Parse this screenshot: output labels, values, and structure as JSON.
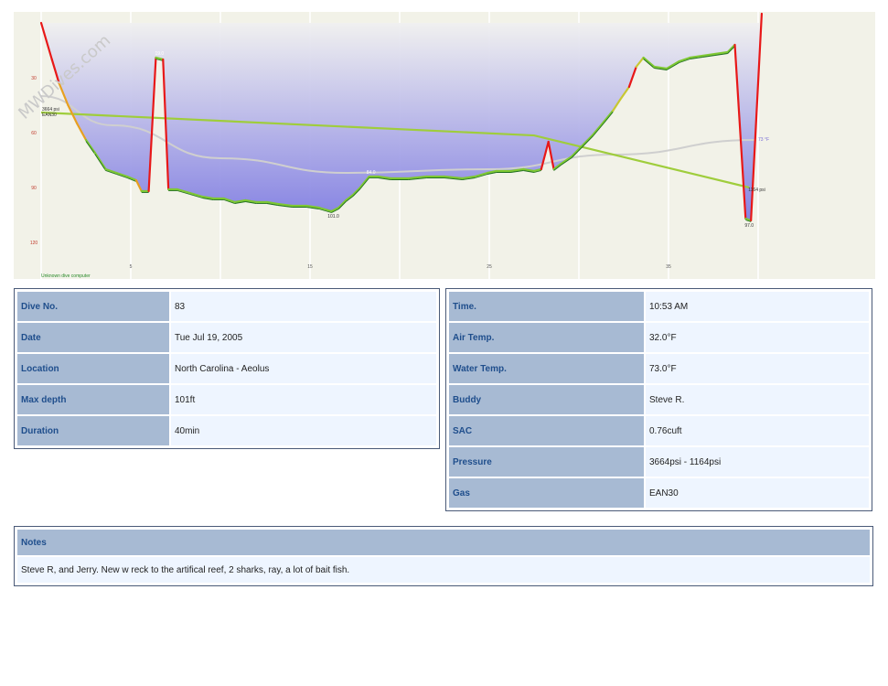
{
  "chart_data": {
    "type": "line",
    "title": "",
    "xlabel": "",
    "ylabel": "",
    "xlim": [
      -1,
      41
    ],
    "ylim": [
      0,
      130
    ],
    "y_inverted": true,
    "x_ticks": [
      5,
      15,
      25,
      35
    ],
    "y_ticks": [
      30,
      60,
      90,
      120
    ],
    "watermark": "MWDives.com",
    "computer_label": "Unknown dive computer",
    "colors": {
      "background": "#f2f2e8",
      "profile_fill": "#8d8ae6",
      "depth_line": "#7ec832",
      "ascent_fast": "#e81818",
      "descent": "#e8a020",
      "pressure": "#6ec832",
      "temperature": "#cccccc"
    },
    "depth_profile": [
      [
        0.0,
        0
      ],
      [
        0.6,
        20
      ],
      [
        1.0,
        33
      ],
      [
        1.5,
        45
      ],
      [
        2.0,
        55
      ],
      [
        2.5,
        64
      ],
      [
        3.0,
        71
      ],
      [
        3.6,
        80
      ],
      [
        4.2,
        82
      ],
      [
        4.8,
        84
      ],
      [
        5.3,
        86
      ],
      [
        5.6,
        92
      ],
      [
        6.0,
        92
      ],
      [
        6.4,
        19
      ],
      [
        6.8,
        20
      ],
      [
        7.1,
        91
      ],
      [
        7.6,
        91
      ],
      [
        8.3,
        93
      ],
      [
        9.0,
        95
      ],
      [
        9.6,
        96
      ],
      [
        10.2,
        96
      ],
      [
        10.8,
        98
      ],
      [
        11.4,
        97
      ],
      [
        12.0,
        98
      ],
      [
        12.6,
        98
      ],
      [
        13.2,
        99
      ],
      [
        14.0,
        100
      ],
      [
        14.8,
        100
      ],
      [
        15.5,
        101
      ],
      [
        16.2,
        103
      ],
      [
        16.6,
        101
      ],
      [
        17.0,
        97
      ],
      [
        17.4,
        94
      ],
      [
        17.8,
        90
      ],
      [
        18.3,
        84
      ],
      [
        18.8,
        84
      ],
      [
        19.5,
        85
      ],
      [
        20.5,
        85
      ],
      [
        21.5,
        84
      ],
      [
        22.5,
        84
      ],
      [
        23.5,
        85
      ],
      [
        24.2,
        84
      ],
      [
        24.9,
        82
      ],
      [
        25.4,
        81
      ],
      [
        26.2,
        81
      ],
      [
        26.9,
        80
      ],
      [
        27.5,
        81
      ],
      [
        27.9,
        80
      ],
      [
        28.3,
        65
      ],
      [
        28.6,
        80
      ],
      [
        29.0,
        77
      ],
      [
        29.6,
        73
      ],
      [
        30.2,
        67
      ],
      [
        30.8,
        61
      ],
      [
        31.4,
        54
      ],
      [
        31.9,
        48
      ],
      [
        32.3,
        42
      ],
      [
        32.8,
        35
      ],
      [
        33.2,
        24
      ],
      [
        33.6,
        19
      ],
      [
        34.2,
        24
      ],
      [
        34.9,
        25
      ],
      [
        35.6,
        21
      ],
      [
        36.2,
        19
      ],
      [
        36.9,
        18
      ],
      [
        37.6,
        17
      ],
      [
        38.3,
        16
      ],
      [
        38.7,
        12
      ],
      [
        39.3,
        107
      ],
      [
        39.6,
        108
      ],
      [
        40.2,
        -5
      ]
    ],
    "pressure_psi": [
      [
        0.0,
        3664
      ],
      [
        27.5,
        2900
      ],
      [
        39.5,
        1164
      ]
    ],
    "temperature_curve": [
      [
        0.0,
        40
      ],
      [
        4.0,
        56
      ],
      [
        10.0,
        74
      ],
      [
        17.0,
        82
      ],
      [
        25.0,
        80
      ],
      [
        32.0,
        72
      ],
      [
        39.8,
        64
      ]
    ],
    "annotations": {
      "start_pressure": "3664 psi",
      "gas": "EAN30",
      "end_pressure": "1164 psi",
      "max_depth_label": "101.0",
      "peak1_label": "19.0",
      "peak2_label": "84.0",
      "final_depth_label": "97.0",
      "temp_label": "73 °F"
    }
  },
  "dive_info": {
    "dive_no_label": "Dive No.",
    "dive_no": "83",
    "date_label": "Date",
    "date": "Tue Jul 19, 2005",
    "location_label": "Location",
    "location": "North Carolina - Aeolus",
    "max_depth_label": "Max depth",
    "max_depth": "101ft",
    "duration_label": "Duration",
    "duration": "40min"
  },
  "conditions": {
    "time_label": "Time.",
    "time": "10:53 AM",
    "air_temp_label": "Air Temp.",
    "air_temp": "32.0°F",
    "water_temp_label": "Water Temp.",
    "water_temp": "73.0°F",
    "buddy_label": "Buddy",
    "buddy": "Steve R.",
    "sac_label": "SAC",
    "sac": "0.76cuft",
    "pressure_label": "Pressure",
    "pressure": "3664psi - 1164psi",
    "gas_label": "Gas",
    "gas": "EAN30"
  },
  "notes": {
    "label": "Notes",
    "text": "Steve R, and Jerry. New  w reck to the artifical reef, 2 sharks, ray, a lot of bait fish."
  }
}
